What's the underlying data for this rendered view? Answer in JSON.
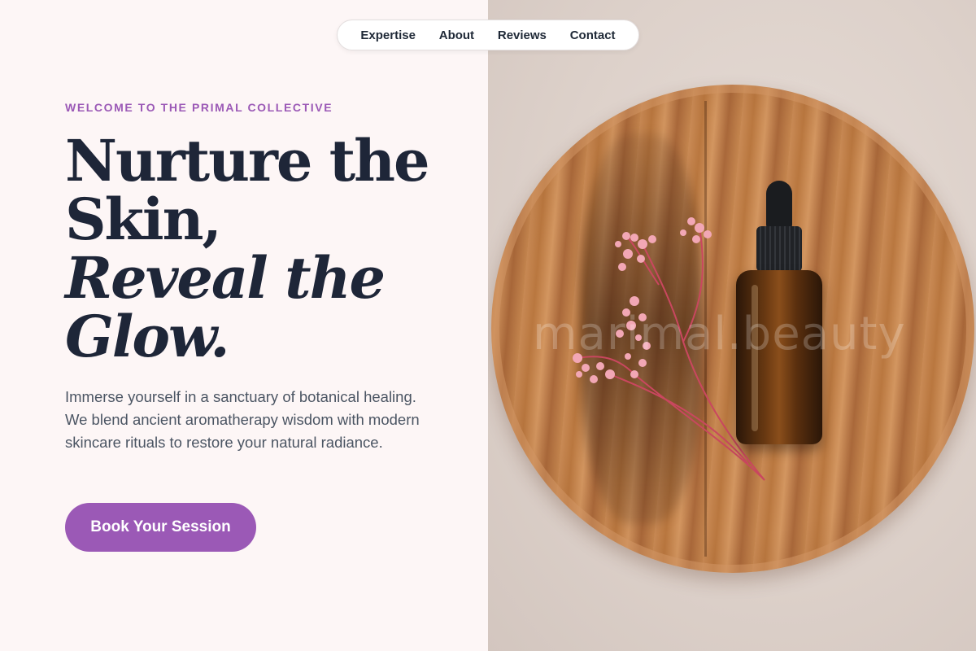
{
  "nav": {
    "items": [
      "Expertise",
      "About",
      "Reviews",
      "Contact"
    ]
  },
  "hero": {
    "eyebrow": "WELCOME TO THE PRIMAL COLLECTIVE",
    "headline_line1": "Nurture the",
    "headline_line2": "Skin,",
    "headline_line3": "Reveal the",
    "headline_line4": "Glow.",
    "body": "Immerse yourself in a sanctuary of botanical healing. We blend ancient aromatherapy wisdom with modern skincare rituals to restore your natural radiance.",
    "cta_label": "Book Your Session"
  },
  "image": {
    "watermark": "marimal.beauty"
  },
  "colors": {
    "accent": "#9b59b6",
    "heading": "#1e2638",
    "body_text": "#4b5563",
    "left_background": "#fdf6f6"
  }
}
